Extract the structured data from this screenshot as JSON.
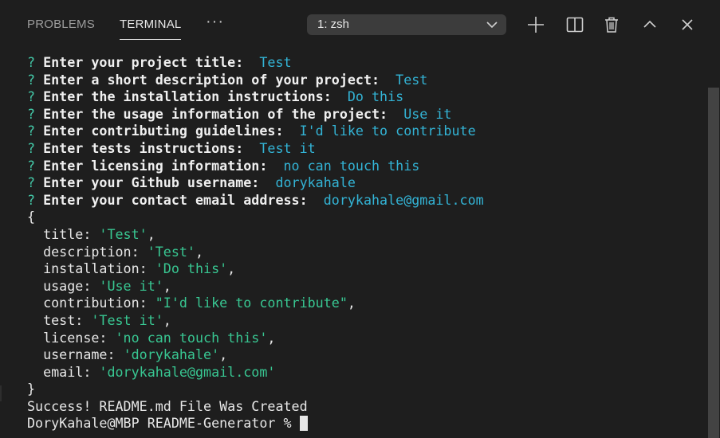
{
  "tabs": {
    "problems": "PROBLEMS",
    "terminal": "TERMINAL",
    "more": "···"
  },
  "terminal_select": {
    "value": "1: zsh"
  },
  "icons": {
    "add": "plus-icon",
    "split": "split-icon",
    "trash": "trash-icon",
    "maximize": "chevron-up-icon",
    "close": "close-icon",
    "dropdown": "chevron-down-icon"
  },
  "prompts": [
    {
      "mark": "?",
      "question": "Enter your project title:",
      "answer": "Test"
    },
    {
      "mark": "?",
      "question": "Enter a short description of your project:",
      "answer": "Test"
    },
    {
      "mark": "?",
      "question": "Enter the installation instructions:",
      "answer": "Do this"
    },
    {
      "mark": "?",
      "question": "Enter the usage information of the project:",
      "answer": "Use it"
    },
    {
      "mark": "?",
      "question": "Enter contributing guidelines:",
      "answer": "I'd like to contribute"
    },
    {
      "mark": "?",
      "question": "Enter tests instructions:",
      "answer": "Test it"
    },
    {
      "mark": "?",
      "question": "Enter licensing information:",
      "answer": "no can touch this"
    },
    {
      "mark": "?",
      "question": "Enter your Github username:",
      "answer": "dorykahale"
    },
    {
      "mark": "?",
      "question": "Enter your contact email address:",
      "answer": "dorykahale@gmail.com"
    }
  ],
  "object": {
    "open": "{",
    "close": "}",
    "entries": [
      {
        "key": "title:",
        "value": "'Test'",
        "comma": ","
      },
      {
        "key": "description:",
        "value": "'Test'",
        "comma": ","
      },
      {
        "key": "installation:",
        "value": "'Do this'",
        "comma": ","
      },
      {
        "key": "usage:",
        "value": "'Use it'",
        "comma": ","
      },
      {
        "key": "contribution:",
        "value": "\"I'd like to contribute\"",
        "comma": ","
      },
      {
        "key": "test:",
        "value": "'Test it'",
        "comma": ","
      },
      {
        "key": "license:",
        "value": "'no can touch this'",
        "comma": ","
      },
      {
        "key": "username:",
        "value": "'dorykahale'",
        "comma": ","
      },
      {
        "key": "email:",
        "value": "'dorykahale@gmail.com'",
        "comma": ""
      }
    ]
  },
  "success": "Success! README.md File Was Created",
  "shell_prompt": "DoryKahale@MBP README-Generator % "
}
